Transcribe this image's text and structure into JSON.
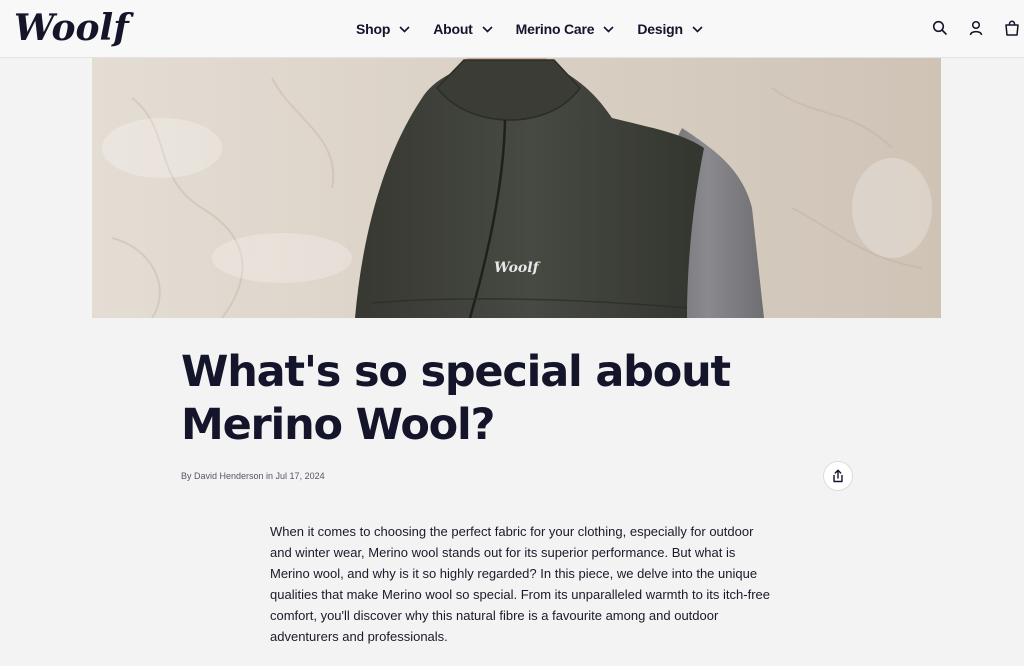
{
  "header": {
    "logo_text": "Woolf",
    "nav": [
      {
        "label": "Shop"
      },
      {
        "label": "About"
      },
      {
        "label": "Merino Care"
      },
      {
        "label": "Design"
      }
    ],
    "icons": [
      "search-icon",
      "account-icon",
      "cart-icon"
    ]
  },
  "hero": {
    "image_description_icon": "hero-image",
    "vest_logo": "Woolf"
  },
  "article": {
    "title": "What's so special about Merino Wool?",
    "byline": "By David Henderson in Jul 17, 2024",
    "paragraph": "When it comes to choosing the perfect fabric for your clothing, especially for outdoor and winter wear, Merino wool stands out for its superior performance. But what is Merino wool, and why is it so highly regarded? In this piece, we delve into the unique qualities that make Merino wool so special. From its unparalleled warmth to its itch-free comfort, you'll discover why this natural fibre is a favourite among and outdoor adventurers and professionals."
  },
  "colors": {
    "text": "#14142b",
    "background": "#f3f3f3",
    "vest": "#3d3f38",
    "shirt": "#7c7c80"
  }
}
